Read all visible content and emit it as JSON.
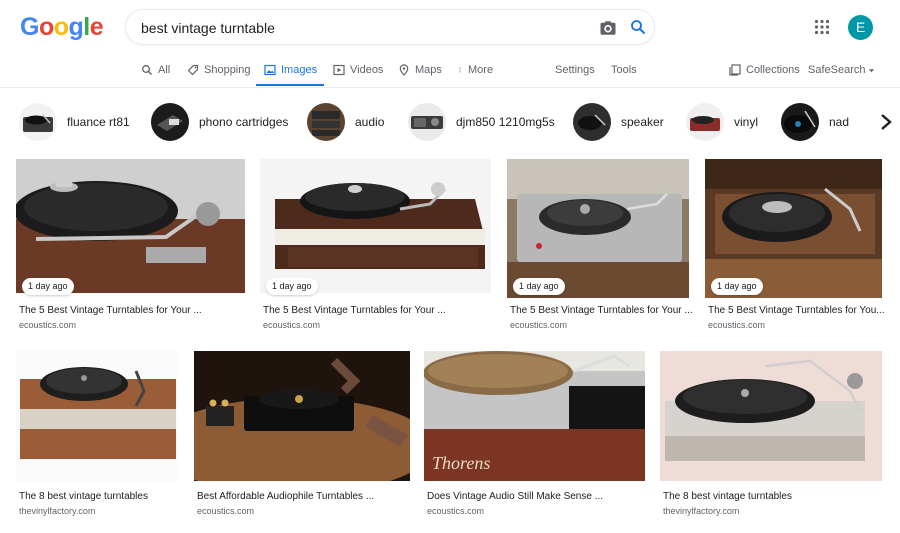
{
  "header": {
    "logo_letters": [
      {
        "ch": "G",
        "color": "#4285f4"
      },
      {
        "ch": "o",
        "color": "#ea4335"
      },
      {
        "ch": "o",
        "color": "#fbbc05"
      },
      {
        "ch": "g",
        "color": "#4285f4"
      },
      {
        "ch": "l",
        "color": "#34a853"
      },
      {
        "ch": "e",
        "color": "#ea4335"
      }
    ],
    "search_value": "best vintage turntable",
    "avatar_letter": "E"
  },
  "tabs": [
    {
      "label": "All",
      "icon": "search-icon",
      "active": false
    },
    {
      "label": "Shopping",
      "icon": "tag-icon",
      "active": false
    },
    {
      "label": "Images",
      "icon": "image-icon",
      "active": true
    },
    {
      "label": "Videos",
      "icon": "play-icon",
      "active": false
    },
    {
      "label": "Maps",
      "icon": "map-pin-icon",
      "active": false
    },
    {
      "label": "More",
      "icon": "more-vert-icon",
      "active": false
    }
  ],
  "tools": {
    "settings": "Settings",
    "tools": "Tools",
    "collections": "Collections",
    "safesearch": "SafeSearch"
  },
  "chips": [
    {
      "label": "fluance rt81"
    },
    {
      "label": "phono cartridges"
    },
    {
      "label": "audio"
    },
    {
      "label": "djm850 1210mg5s"
    },
    {
      "label": "speaker"
    },
    {
      "label": "vinyl"
    },
    {
      "label": "nad"
    }
  ],
  "results": [
    {
      "title": "The 5 Best Vintage Turntables for Your ...",
      "source": "ecoustics.com",
      "badge": "1 day ago"
    },
    {
      "title": "The 5 Best Vintage Turntables for Your ...",
      "source": "ecoustics.com",
      "badge": "1 day ago"
    },
    {
      "title": "The 5 Best Vintage Turntables for Your ...",
      "source": "ecoustics.com",
      "badge": "1 day ago"
    },
    {
      "title": "The 5 Best Vintage Turntables for You...",
      "source": "ecoustics.com",
      "badge": "1 day ago"
    },
    {
      "title": "The 8 best vintage turntables",
      "source": "thevinylfactory.com"
    },
    {
      "title": "Best Affordable Audiophile Turntables ...",
      "source": "ecoustics.com"
    },
    {
      "title": "Does Vintage Audio Still Make Sense ...",
      "source": "ecoustics.com"
    },
    {
      "title": "The 8 best vintage turntables",
      "source": "thevinylfactory.com"
    }
  ],
  "colors": {
    "accent": "#1a73e8",
    "avatar": "#0097a7"
  }
}
